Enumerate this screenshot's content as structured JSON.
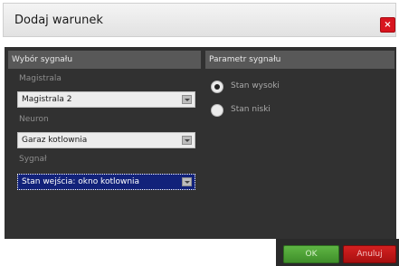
{
  "dialog": {
    "title": "Dodaj warunek",
    "close_glyph": "×"
  },
  "signal_selection": {
    "header": "Wybór sygnału",
    "bus": {
      "label": "Magistrala",
      "value": "Magistrala 2"
    },
    "neuron": {
      "label": "Neuron",
      "value": "Garaz kotlownia"
    },
    "signal": {
      "label": "Sygnał",
      "value": "Stan wejścia: okno kotlownia"
    }
  },
  "signal_parameter": {
    "header": "Parametr sygnału",
    "options": [
      {
        "label": "Stan wysoki",
        "selected": true
      },
      {
        "label": "Stan niski",
        "selected": false
      }
    ]
  },
  "buttons": {
    "ok": "OK",
    "cancel": "Anuluj"
  },
  "colors": {
    "close": "#d8151f",
    "ok": "#4ea338",
    "cancel": "#c01818",
    "panel_bg": "#313131",
    "selected_field": "#12227a"
  },
  "icons": {
    "close": "close-icon",
    "dropdown": "chevron-down-icon",
    "radio_checked": "radio-checked-icon",
    "radio_unchecked": "radio-unchecked-icon"
  }
}
